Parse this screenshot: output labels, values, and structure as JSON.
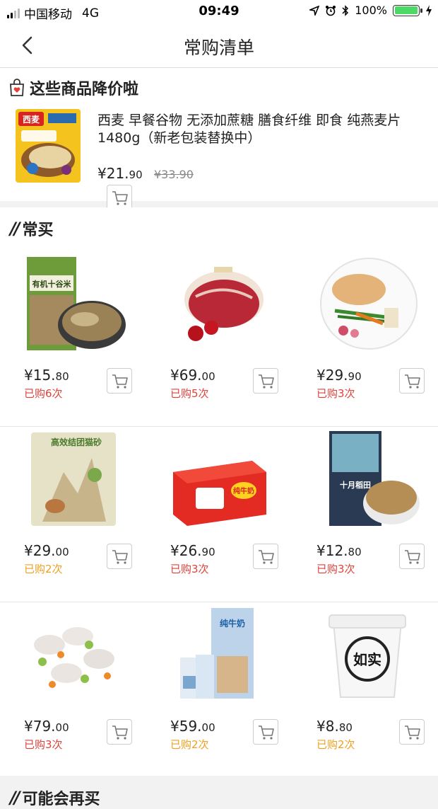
{
  "status": {
    "carrier": "中国移动",
    "network": "4G",
    "time": "09:49",
    "battery": "100%",
    "battery_level": 1.0
  },
  "nav": {
    "title": "常购清单",
    "back_icon": "chevron-left-icon"
  },
  "price_drop": {
    "heading": "这些商品降价啦",
    "heading_icon": "shopping-bag-heart-icon",
    "product": {
      "title": "西麦 早餐谷物 无添加蔗糖 膳食纤维 即食 纯燕麦片1480g（新老包装替换中）",
      "price_int": "¥21.",
      "price_dec": "90",
      "old_price": "¥33.90",
      "image": "oatmeal-bag-image",
      "package_brand": "西麦"
    }
  },
  "frequent": {
    "heading": "常买",
    "items": [
      {
        "image": "organic-grains-image",
        "package_text": "有机十谷米",
        "price_int": "¥15.",
        "price_dec": "80",
        "bought": "已购6次",
        "bought_color": "#e0413a"
      },
      {
        "image": "beef-shank-image",
        "price_int": "¥69.",
        "price_dec": "00",
        "bought": "已购5次",
        "bought_color": "#e0413a"
      },
      {
        "image": "salmon-plate-image",
        "price_int": "¥29.",
        "price_dec": "90",
        "bought": "已购3次",
        "bought_color": "#e0413a"
      },
      {
        "image": "cat-litter-bag-image",
        "package_text": "高效结团猫砂",
        "price_int": "¥29.",
        "price_dec": "00",
        "bought": "已购2次",
        "bought_color": "#f0a020"
      },
      {
        "image": "milk-box-image",
        "package_text": "纯牛奶",
        "price_int": "¥26.",
        "price_dec": "90",
        "bought": "已购3次",
        "bought_color": "#e0413a"
      },
      {
        "image": "brown-rice-bag-image",
        "package_text": "十月稻田",
        "price_int": "¥12.",
        "price_dec": "80",
        "bought": "已购3次",
        "bought_color": "#e0413a"
      },
      {
        "image": "shrimp-beans-image",
        "price_int": "¥79.",
        "price_dec": "00",
        "bought": "已购3次",
        "bought_color": "#e0413a"
      },
      {
        "image": "pure-milk-cartons-image",
        "package_text": "纯牛奶",
        "price_int": "¥59.",
        "price_dec": "00",
        "bought": "已购2次",
        "bought_color": "#f0a020"
      },
      {
        "image": "yogurt-cup-image",
        "package_text": "如实",
        "price_int": "¥8.",
        "price_dec": "80",
        "bought": "已购2次",
        "bought_color": "#f0a020"
      }
    ]
  },
  "maybe_buy": {
    "heading": "可能会再买"
  },
  "colors": {
    "accent_red": "#e0413a",
    "accent_orange": "#f0a020",
    "battery_green": "#4cd964"
  }
}
